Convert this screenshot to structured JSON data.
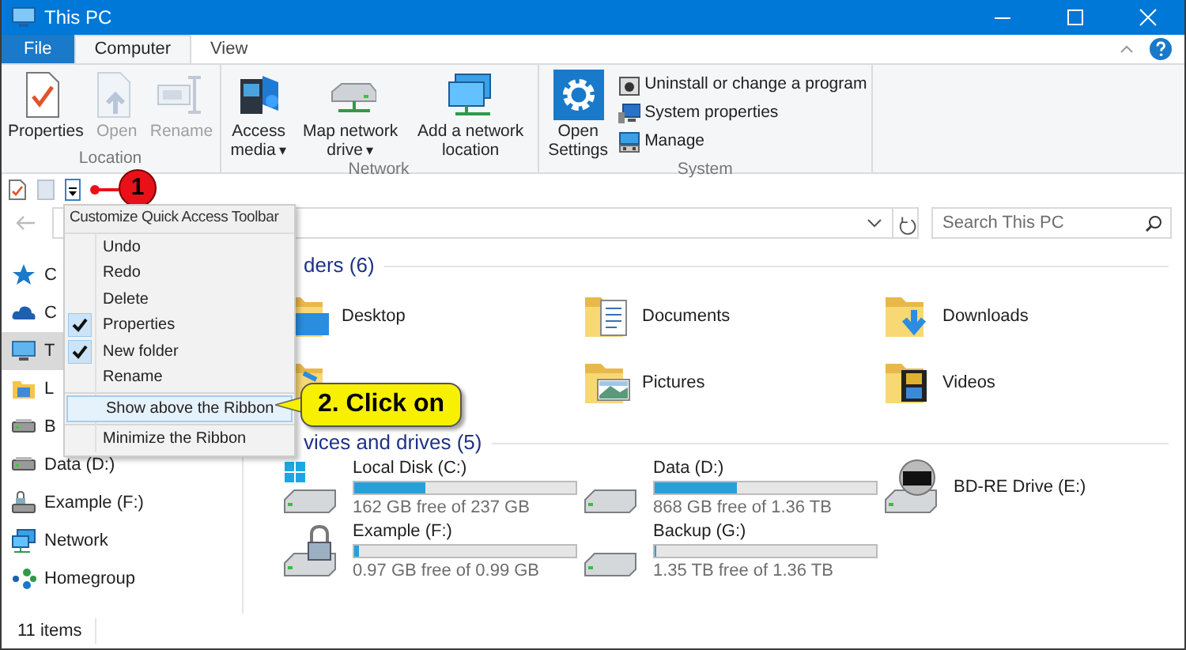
{
  "window": {
    "title": "This PC"
  },
  "tabs": [
    {
      "label": "File",
      "kind": "file",
      "selected": false
    },
    {
      "label": "Computer",
      "kind": "tab",
      "selected": true
    },
    {
      "label": "View",
      "kind": "tab",
      "selected": false
    }
  ],
  "ribbon": {
    "groups": [
      {
        "label": "Location",
        "buttons": [
          {
            "label": "Properties",
            "kind": "properties",
            "disabled": false
          },
          {
            "label": "Open",
            "kind": "open",
            "disabled": true
          },
          {
            "label": "Rename",
            "kind": "rename",
            "disabled": true
          }
        ]
      },
      {
        "label": "Network",
        "buttons": [
          {
            "label": "Access media",
            "kind": "media",
            "arrow": "▾",
            "disabled": false
          },
          {
            "label": "Map network drive",
            "kind": "mapdrive",
            "arrow": "▾",
            "disabled": false
          },
          {
            "label": "Add a network location",
            "kind": "netloc",
            "disabled": false
          }
        ]
      },
      {
        "label": "System",
        "buttons": [
          {
            "label": "Open Settings",
            "kind": "settings",
            "disabled": false
          }
        ],
        "small": [
          {
            "label": "Uninstall or change a program",
            "kind": "uninstall"
          },
          {
            "label": "System properties",
            "kind": "sysprops"
          },
          {
            "label": "Manage",
            "kind": "manage"
          }
        ]
      }
    ]
  },
  "quick_access_marker": "1",
  "search": {
    "placeholder": "Search This PC"
  },
  "menu": {
    "title": "Customize Quick Access Toolbar",
    "sections": [
      [
        {
          "label": "Undo",
          "checked": false,
          "selected": false
        },
        {
          "label": "Redo",
          "checked": false,
          "selected": false
        },
        {
          "label": "Delete",
          "checked": false,
          "selected": false
        },
        {
          "label": "Properties",
          "checked": true,
          "selected": false
        },
        {
          "label": "New folder",
          "checked": true,
          "selected": false
        },
        {
          "label": "Rename",
          "checked": false,
          "selected": false
        }
      ],
      [
        {
          "label": "Show above the Ribbon",
          "checked": false,
          "selected": true
        }
      ],
      [
        {
          "label": "Minimize the Ribbon",
          "checked": false,
          "selected": false
        }
      ]
    ]
  },
  "callout": "2. Click on",
  "sidebar": {
    "items": [
      {
        "label": "C",
        "kind": "star",
        "selected": false
      },
      {
        "label": "C",
        "kind": "cloud",
        "selected": false
      },
      {
        "label": "T",
        "kind": "pc",
        "selected": true
      },
      {
        "label": "L",
        "kind": "library",
        "selected": false
      },
      {
        "label": "B",
        "kind": "drive",
        "selected": false
      },
      {
        "label": "Data (D:)",
        "kind": "drive",
        "selected": false
      },
      {
        "label": "Example (F:)",
        "kind": "locked",
        "selected": false
      },
      {
        "label": "Network",
        "kind": "network",
        "selected": false
      },
      {
        "label": "Homegroup",
        "kind": "homegroup",
        "selected": false
      }
    ]
  },
  "folders": {
    "header": "ders (6)",
    "items": [
      {
        "label": "Desktop",
        "kind": "desktop"
      },
      {
        "label": "Documents",
        "kind": "documents"
      },
      {
        "label": "Downloads",
        "kind": "downloads"
      },
      {
        "kind": "music"
      },
      {
        "label": "Pictures",
        "kind": "pictures"
      },
      {
        "label": "Videos",
        "kind": "videos"
      }
    ]
  },
  "drives": {
    "header": "vices and drives (5)",
    "items": [
      {
        "label": "Local Disk (C:)",
        "free": "162 GB free of 237 GB",
        "level": 0.32,
        "kind": "system"
      },
      {
        "label": "Data (D:)",
        "free": "868 GB free of 1.36 TB",
        "level": 0.37,
        "kind": "hdd"
      },
      {
        "label": "BD-RE Drive (E:)",
        "kind": "optical"
      },
      {
        "label": "Example (F:)",
        "free": "0.97 GB free of 0.99 GB",
        "level": 0.02,
        "kind": "locked"
      },
      {
        "label": "Backup (G:)",
        "free": "1.35 TB free of 1.36 TB",
        "level": 0.01,
        "kind": "hdd"
      }
    ]
  },
  "status_bar": {
    "text": "11 items"
  }
}
